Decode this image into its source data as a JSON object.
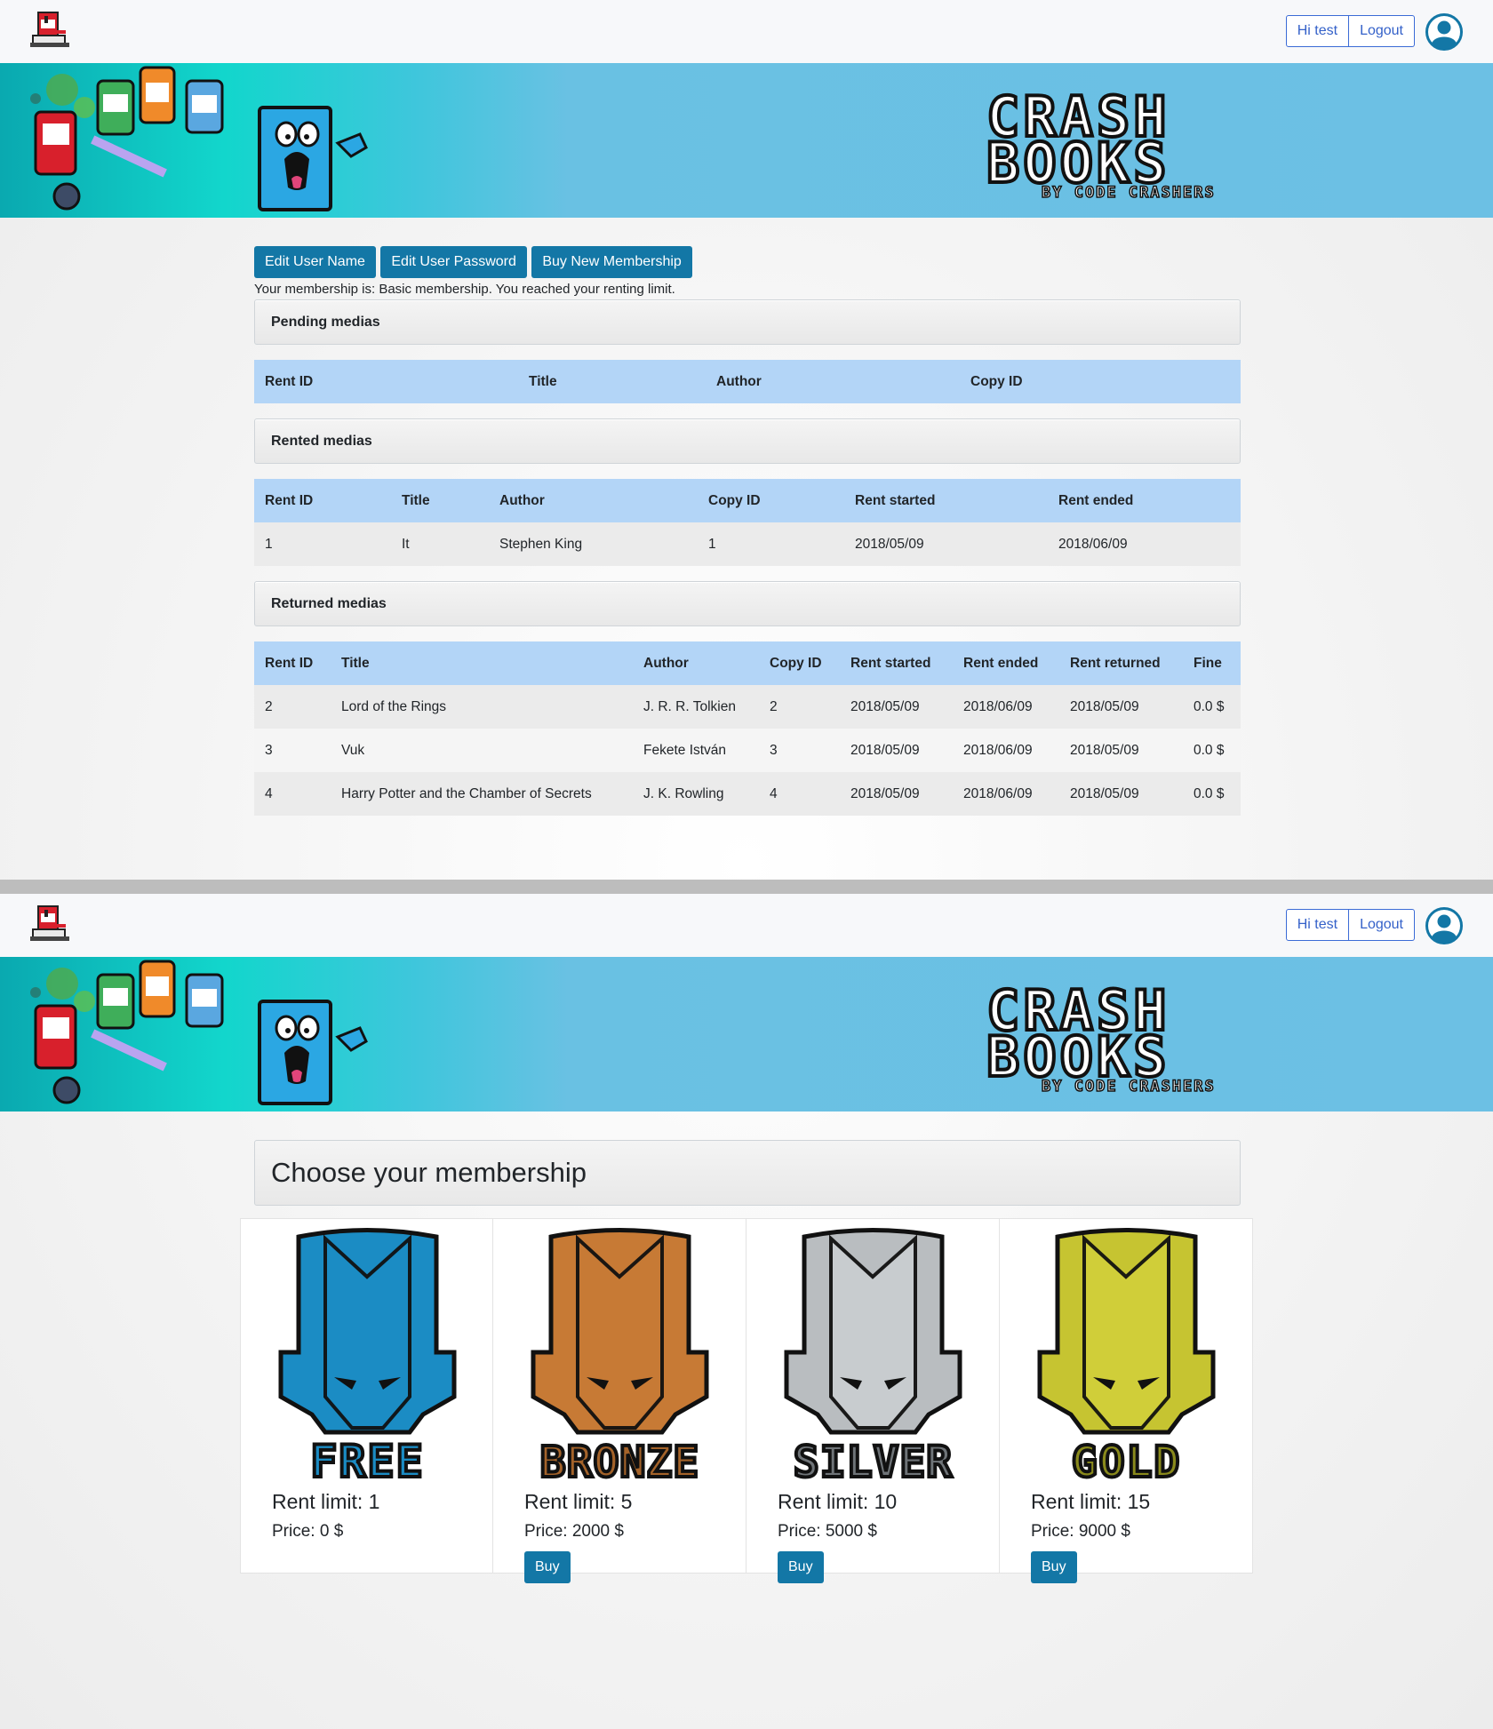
{
  "nav": {
    "greeting": "Hi test",
    "logout": "Logout"
  },
  "brand": {
    "line1": "CRASH",
    "line2": "BOOKS",
    "tagline": "BY CODE CRASHERS"
  },
  "actions": {
    "edit_name": "Edit User Name",
    "edit_password": "Edit User Password",
    "buy_membership": "Buy New Membership"
  },
  "membership_note": "Your membership is: Basic membership. You reached your renting limit.",
  "pending": {
    "heading": "Pending medias",
    "columns": [
      "Rent ID",
      "Title",
      "Author",
      "Copy ID"
    ]
  },
  "rented": {
    "heading": "Rented medias",
    "columns": [
      "Rent ID",
      "Title",
      "Author",
      "Copy ID",
      "Rent started",
      "Rent ended"
    ],
    "rows": [
      [
        "1",
        "It",
        "Stephen King",
        "1",
        "2018/05/09",
        "2018/06/09"
      ]
    ]
  },
  "returned": {
    "heading": "Returned medias",
    "columns": [
      "Rent ID",
      "Title",
      "Author",
      "Copy ID",
      "Rent started",
      "Rent ended",
      "Rent returned",
      "Fine"
    ],
    "rows": [
      [
        "2",
        "Lord of the Rings",
        "J. R. R. Tolkien",
        "2",
        "2018/05/09",
        "2018/06/09",
        "2018/05/09",
        "0.0 $"
      ],
      [
        "3",
        "Vuk",
        "Fekete István",
        "3",
        "2018/05/09",
        "2018/06/09",
        "2018/05/09",
        "0.0 $"
      ],
      [
        "4",
        "Harry Potter and the Chamber of Secrets",
        "J. K. Rowling",
        "4",
        "2018/05/09",
        "2018/06/09",
        "2018/05/09",
        "0.0 $"
      ]
    ]
  },
  "choose": {
    "heading": "Choose your membership",
    "tiers": [
      {
        "name": "FREE",
        "limit": "Rent limit: 1",
        "price": "Price: 0 $",
        "buy": "",
        "color": "#1b8cc4",
        "dark": "#0f4f73"
      },
      {
        "name": "BRONZE",
        "limit": "Rent limit: 5",
        "price": "Price: 2000 $",
        "buy": "Buy",
        "color": "#c77a35",
        "dark": "#6a3b15"
      },
      {
        "name": "SILVER",
        "limit": "Rent limit: 10",
        "price": "Price: 5000 $",
        "buy": "Buy",
        "color": "#b9bdc0",
        "dark": "#5d6266"
      },
      {
        "name": "GOLD",
        "limit": "Rent limit: 15",
        "price": "Price: 9000 $",
        "buy": "Buy",
        "color": "#c6c431",
        "dark": "#6b6a14"
      }
    ]
  }
}
